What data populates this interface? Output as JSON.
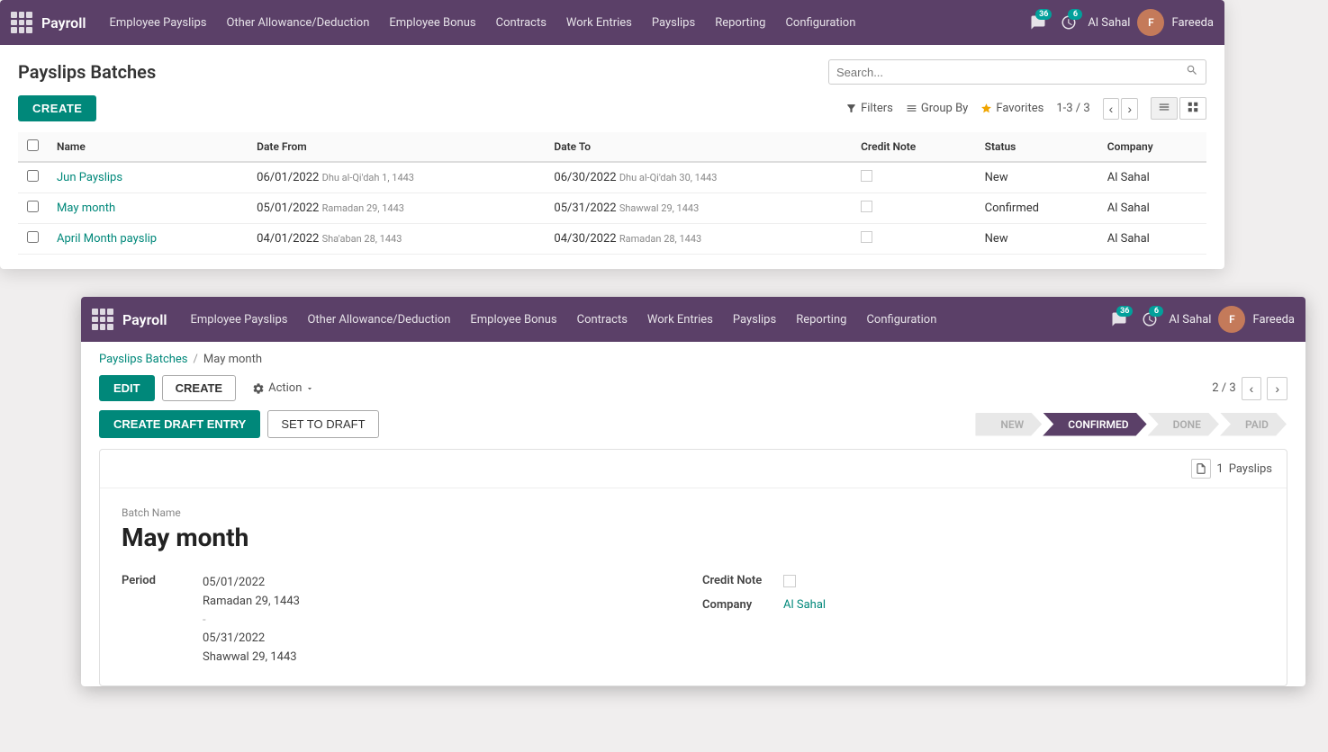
{
  "app": {
    "brand": "Payroll",
    "nav_items": [
      "Employee Payslips",
      "Other Allowance/Deduction",
      "Employee Bonus",
      "Contracts",
      "Work Entries",
      "Payslips",
      "Reporting",
      "Configuration"
    ],
    "user": "Al Sahal",
    "avatar_initials": "F",
    "avatar_name": "Fareeda",
    "badge_messages": "36",
    "badge_activity": "6"
  },
  "list_window": {
    "title": "Payslips Batches",
    "create_label": "CREATE",
    "search_placeholder": "Search...",
    "filters_label": "Filters",
    "groupby_label": "Group By",
    "favorites_label": "Favorites",
    "pagination": "1-3 / 3",
    "columns": [
      "Name",
      "Date From",
      "Date To",
      "Credit Note",
      "Status",
      "Company"
    ],
    "rows": [
      {
        "name": "Jun Payslips",
        "date_from": "06/01/2022",
        "date_from_hijri": "Dhu al-Qi'dah 1, 1443",
        "date_to": "06/30/2022",
        "date_to_hijri": "Dhu al-Qi'dah 30, 1443",
        "status": "New",
        "company": "Al Sahal"
      },
      {
        "name": "May month",
        "date_from": "05/01/2022",
        "date_from_hijri": "Ramadan 29, 1443",
        "date_to": "05/31/2022",
        "date_to_hijri": "Shawwal 29, 1443",
        "status": "Confirmed",
        "company": "Al Sahal"
      },
      {
        "name": "April Month payslip",
        "date_from": "04/01/2022",
        "date_from_hijri": "Sha'aban 28, 1443",
        "date_to": "04/30/2022",
        "date_to_hijri": "Ramadan 28, 1443",
        "status": "New",
        "company": "Al Sahal"
      }
    ]
  },
  "detail_window": {
    "breadcrumb_parent": "Payslips Batches",
    "breadcrumb_current": "May month",
    "edit_label": "EDIT",
    "create_label": "CREATE",
    "action_label": "Action",
    "pagination": "2 / 3",
    "btn_draft_entry": "CREATE DRAFT ENTRY",
    "btn_set_draft": "SET TO DRAFT",
    "pipeline_steps": [
      {
        "label": "NEW",
        "active": false
      },
      {
        "label": "CONFIRMED",
        "active": true
      },
      {
        "label": "DONE",
        "active": false
      },
      {
        "label": "PAID",
        "active": false
      }
    ],
    "payslips_count": "1",
    "payslips_label": "Payslips",
    "batch_name_label": "Batch Name",
    "batch_name": "May month",
    "period_label": "Period",
    "period_date_from": "05/01/2022",
    "period_date_from_hijri": "Ramadan 29, 1443",
    "period_separator": "-",
    "period_date_to": "05/31/2022",
    "period_date_to_hijri": "Shawwal 29, 1443",
    "credit_note_label": "Credit Note",
    "company_label": "Company",
    "company_value": "Al Sahal"
  }
}
